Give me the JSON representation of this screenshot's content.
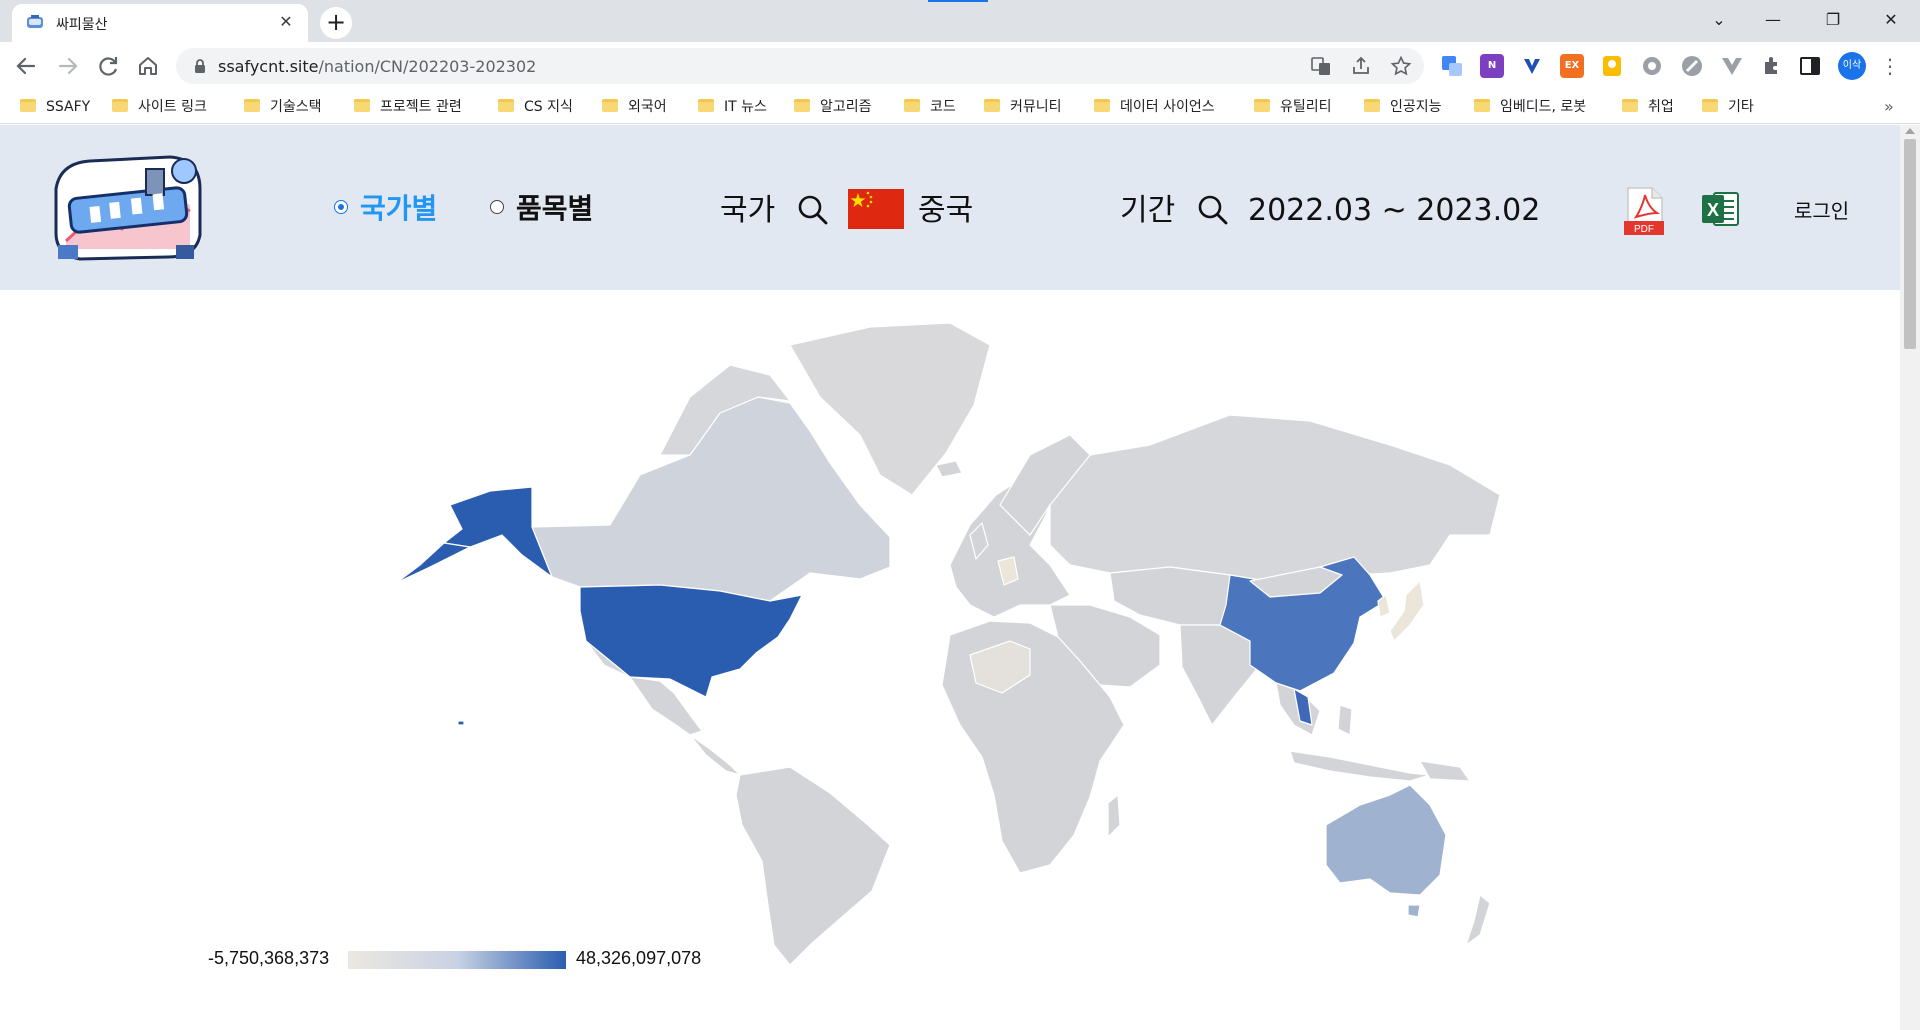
{
  "browser": {
    "tab_title": "싸피물산",
    "tab_close": "✕",
    "new_tab": "+",
    "window_controls": {
      "minimize": "—",
      "restore": "❐",
      "close": "✕",
      "tab_search": "⌄"
    },
    "url_host": "ssafycnt.site",
    "url_path": "/nation/CN/202203-202302",
    "profile_label": "이삭",
    "extensions": [
      "translate-icon",
      "onenote-icon",
      "v-extension-icon",
      "ex-extension-icon",
      "keep-icon",
      "gear-extension-icon",
      "circle-extension-icon",
      "vue-devtools-icon",
      "puzzle-icon",
      "sidepanel-icon"
    ],
    "ext_labels": {
      "onenote": "N",
      "ex": "EX"
    },
    "bookmarks": [
      "SSAFY",
      "사이트 링크",
      "기술스택",
      "프로젝트 관련",
      "CS 지식",
      "외국어",
      "IT 뉴스",
      "알고리즘",
      "코드",
      "커뮤니티",
      "데이터 사이언스",
      "유틸리티",
      "인공지능",
      "임베디드, 로봇",
      "취업",
      "기타"
    ],
    "bookmarks_more": "»"
  },
  "header": {
    "radio_nation": "국가별",
    "radio_item": "품목별",
    "country_label": "국가",
    "country_name": "중국",
    "period_label": "기간",
    "period_value": "2022.03 ~ 2023.02",
    "pdf_label": "PDF",
    "excel_label": "X",
    "login": "로그인"
  },
  "map": {
    "highlight_colors": {
      "usa": "#2a5db0",
      "alaska": "#2a5db0",
      "china": "#4b76be",
      "australia": "#9fb2cf",
      "vietnam": "#3f69b8",
      "default": "#d3d4d8",
      "low": "#ece5d9"
    },
    "legend_min": "-5,750,368,373",
    "legend_max": "48,326,097,078"
  }
}
